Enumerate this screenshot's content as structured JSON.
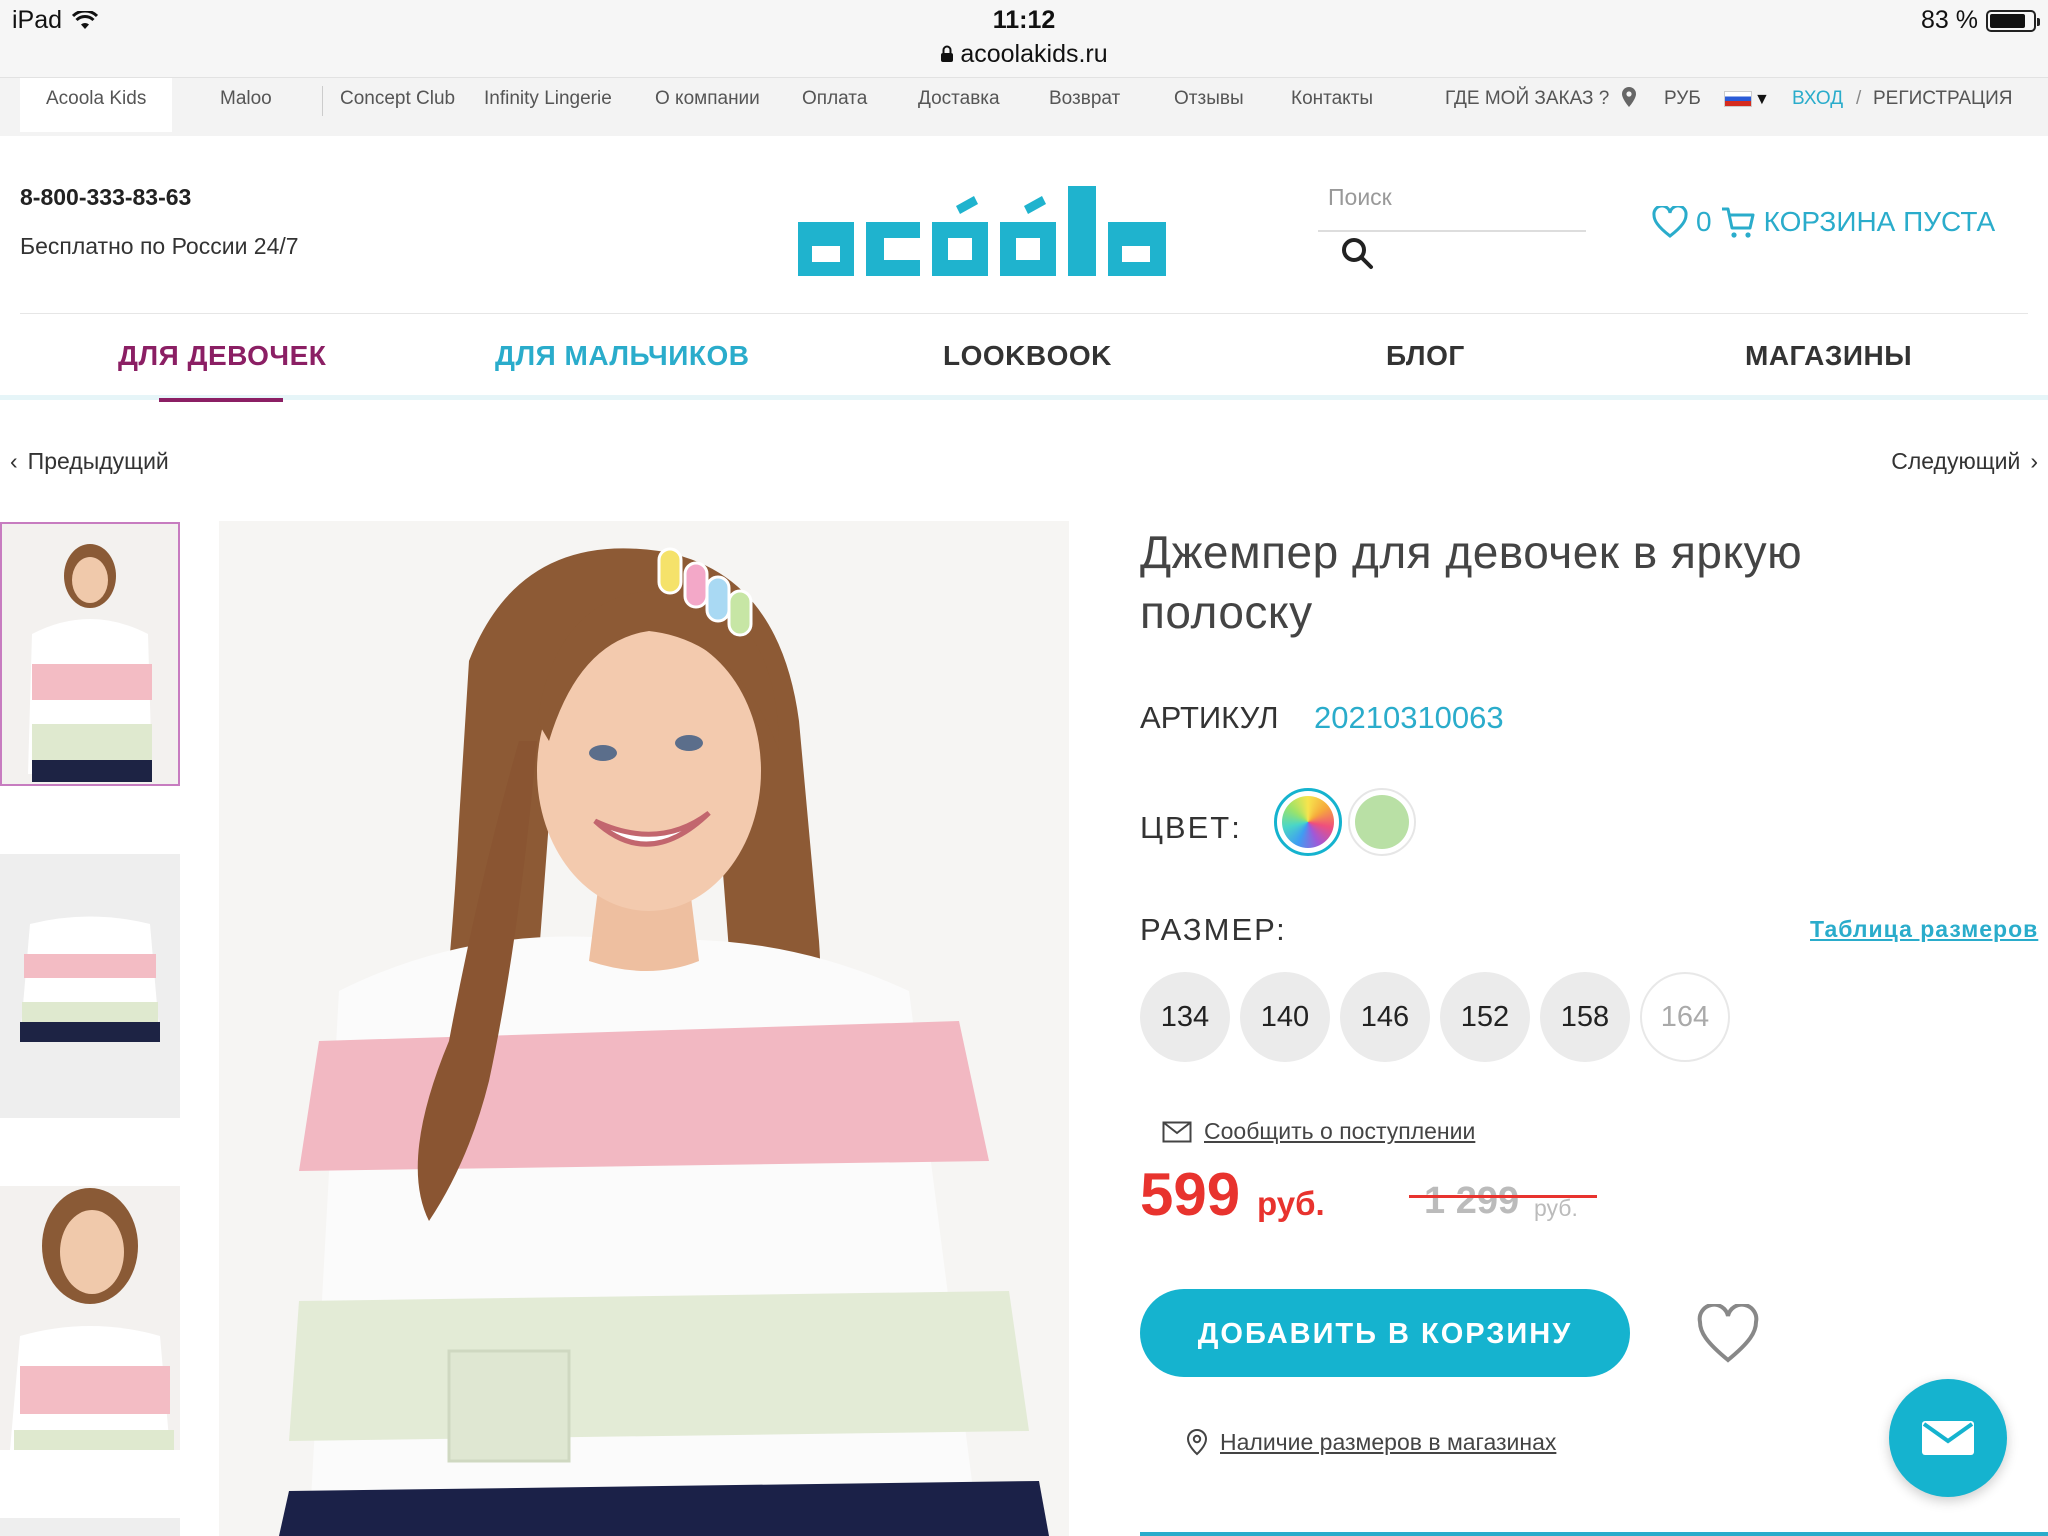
{
  "status_bar": {
    "device": "iPad",
    "time": "11:12",
    "url": "acoolakids.ru",
    "battery": "83 %",
    "battery_level": 0.83
  },
  "top_nav": {
    "brands": [
      "Acoola Kids",
      "Maloo",
      "Concept Club",
      "Infinity Lingerie"
    ],
    "links": [
      "О компании",
      "Оплата",
      "Доставка",
      "Возврат",
      "Отзывы",
      "Контакты"
    ],
    "order_status": "ГДЕ МОЙ ЗАКАЗ ?",
    "currency": "РУБ",
    "login": "ВХОД",
    "separator": "/",
    "register": "РЕГИСТРАЦИЯ"
  },
  "header": {
    "phone": "8-800-333-83-63",
    "phone_note": "Бесплатно по России 24/7",
    "search_placeholder": "Поиск",
    "wishlist_count": "0",
    "cart_text": "КОРЗИНА ПУСТА",
    "logo_color": "#1fb3ce"
  },
  "main_nav": [
    "ДЛЯ ДЕВОЧЕК",
    "ДЛЯ МАЛЬЧИКОВ",
    "LOOKBOOK",
    "БЛОГ",
    "МАГАЗИНЫ"
  ],
  "pager": {
    "prev": "Предыдущий",
    "next": "Следующий"
  },
  "product": {
    "title": "Джемпер для девочек в яркую полоску",
    "sku_label": "АРТИКУЛ",
    "sku": "20210310063",
    "color_label": "ЦВЕТ:",
    "colors": [
      "rainbow",
      "#b9e0a5"
    ],
    "size_label": "РАЗМЕР:",
    "size_table": "Таблица размеров",
    "sizes": [
      "134",
      "140",
      "146",
      "152",
      "158",
      "164"
    ],
    "notify": "Сообщить о поступлении",
    "price": "599",
    "price_currency": "руб.",
    "old_price": "1 299",
    "old_currency": "руб.",
    "add_to_cart": "ДОБАВИТЬ В КОРЗИНУ",
    "availability": "Наличие размеров в магазинах"
  },
  "colors": {
    "accent": "#15b3cf",
    "girls": "#8b1f64",
    "price": "#e8332e"
  }
}
